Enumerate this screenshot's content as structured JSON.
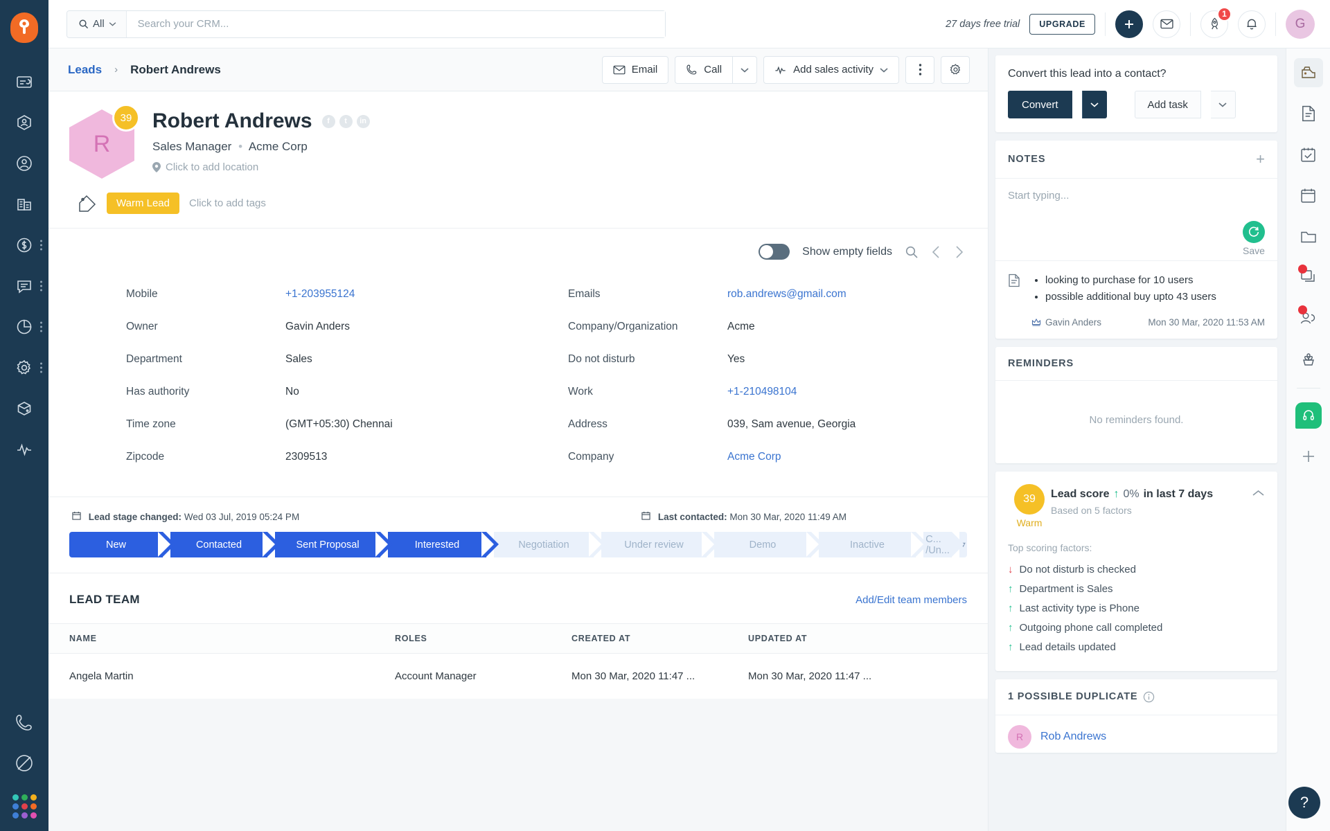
{
  "topbar": {
    "search_scope": "All",
    "search_placeholder": "Search your CRM...",
    "trial_text": "27 days free trial",
    "upgrade_label": "UPGRADE",
    "notification_badge": "1",
    "user_initial": "G"
  },
  "sidebar": {
    "items": [
      {
        "name": "dashboard",
        "label": "Dashboard",
        "dots": false
      },
      {
        "name": "leads",
        "label": "Leads",
        "dots": false
      },
      {
        "name": "contacts",
        "label": "Contacts",
        "dots": false
      },
      {
        "name": "accounts",
        "label": "Accounts",
        "dots": false
      },
      {
        "name": "deals",
        "label": "Deals",
        "dots": true
      },
      {
        "name": "conversations",
        "label": "Conversations",
        "dots": true
      },
      {
        "name": "reports",
        "label": "Reports",
        "dots": true
      },
      {
        "name": "settings",
        "label": "Settings",
        "dots": true
      },
      {
        "name": "products",
        "label": "Products",
        "dots": false
      },
      {
        "name": "activity",
        "label": "Activity",
        "dots": false
      }
    ],
    "bottom": [
      {
        "name": "phone",
        "label": "Phone"
      },
      {
        "name": "freshsales-leaf",
        "label": "Freshsales"
      }
    ]
  },
  "breadcrumb": {
    "parent": "Leads",
    "separator": "›",
    "current": "Robert Andrews"
  },
  "header_actions": {
    "email": "Email",
    "call": "Call",
    "add_sales_activity": "Add sales activity"
  },
  "profile": {
    "initial": "R",
    "score": "39",
    "name": "Robert Andrews",
    "job_title": "Sales Manager",
    "separator": "•",
    "company": "Acme Corp",
    "location_placeholder": "Click to add location",
    "tag": "Warm Lead",
    "tag_placeholder": "Click to add tags",
    "socials": [
      "facebook-icon",
      "twitter-icon",
      "linkedin-icon"
    ]
  },
  "fields_toolbar": {
    "show_empty_fields": "Show empty fields"
  },
  "fields": {
    "left": [
      {
        "label": "Mobile",
        "value": "+1-203955124",
        "link": true
      },
      {
        "label": "Owner",
        "value": "Gavin Anders",
        "link": false
      },
      {
        "label": "Department",
        "value": "Sales",
        "link": false
      },
      {
        "label": "Has authority",
        "value": "No",
        "link": false
      },
      {
        "label": "Time zone",
        "value": "(GMT+05:30) Chennai",
        "link": false
      },
      {
        "label": "Zipcode",
        "value": "2309513",
        "link": false
      }
    ],
    "right": [
      {
        "label": "Emails",
        "value": "rob.andrews@gmail.com",
        "link": true
      },
      {
        "label": "Company/Organization",
        "value": "Acme",
        "link": false
      },
      {
        "label": "Do not disturb",
        "value": "Yes",
        "link": false
      },
      {
        "label": "Work",
        "value": "+1-210498104",
        "link": true
      },
      {
        "label": "Address",
        "value": "039, Sam avenue, Georgia",
        "link": false
      },
      {
        "label": "Company",
        "value": "Acme Corp",
        "link": true
      }
    ]
  },
  "stage_section": {
    "changed_label": "Lead stage changed:",
    "changed_value": "Wed 03 Jul, 2019 05:24 PM",
    "contacted_label": "Last contacted:",
    "contacted_value": "Mon 30 Mar, 2020 11:49 AM",
    "stages": [
      {
        "label": "New",
        "done": true
      },
      {
        "label": "Contacted",
        "done": true
      },
      {
        "label": "Sent Proposal",
        "done": true
      },
      {
        "label": "Interested",
        "done": true
      },
      {
        "label": "Negotiation",
        "done": false
      },
      {
        "label": "Under review",
        "done": false
      },
      {
        "label": "Demo",
        "done": false
      },
      {
        "label": "Inactive",
        "done": false
      },
      {
        "label": "C... /Un...",
        "done": false
      }
    ]
  },
  "lead_team": {
    "title": "LEAD TEAM",
    "add_link": "Add/Edit team members",
    "columns": [
      "NAME",
      "ROLES",
      "CREATED AT",
      "UPDATED AT"
    ],
    "rows": [
      {
        "name": "Angela Martin",
        "role": "Account Manager",
        "created_at": "Mon 30 Mar, 2020 11:47 ...",
        "updated_at": "Mon 30 Mar, 2020 11:47 ..."
      }
    ]
  },
  "right_panel": {
    "convert": {
      "question": "Convert this lead into a contact?",
      "convert_label": "Convert",
      "add_task_label": "Add task"
    },
    "notes": {
      "title": "NOTES",
      "compose_placeholder": "Start typing...",
      "save_label": "Save",
      "entries": [
        {
          "bullets": [
            "looking to purchase for 10 users",
            "possible additional buy upto 43 users"
          ],
          "author": "Gavin Anders",
          "timestamp": "Mon 30 Mar, 2020 11:53 AM"
        }
      ]
    },
    "reminders": {
      "title": "REMINDERS",
      "empty": "No reminders found."
    },
    "lead_score": {
      "score": "39",
      "temperature": "Warm",
      "title": "Lead score",
      "change": "0%",
      "change_direction": "up",
      "change_suffix": "in last 7 days",
      "subtitle": "Based on 5 factors",
      "factors_label": "Top scoring factors:",
      "factors": [
        {
          "text": "Do not disturb is checked",
          "direction": "down"
        },
        {
          "text": "Department is Sales",
          "direction": "up"
        },
        {
          "text": "Last activity type is Phone",
          "direction": "up"
        },
        {
          "text": "Outgoing phone call completed",
          "direction": "up"
        },
        {
          "text": "Lead details updated",
          "direction": "up"
        }
      ]
    },
    "duplicates": {
      "title": "1 POSSIBLE DUPLICATE",
      "items": [
        {
          "initial": "R",
          "name": "Rob Andrews"
        }
      ]
    }
  },
  "right_rail": {
    "items": [
      {
        "name": "highlights",
        "badge": false,
        "active": true
      },
      {
        "name": "notes",
        "badge": false,
        "active": false
      },
      {
        "name": "tasks",
        "badge": false,
        "active": false
      },
      {
        "name": "appointments",
        "badge": false,
        "active": false
      },
      {
        "name": "files",
        "badge": false,
        "active": false
      },
      {
        "name": "emails",
        "badge": true,
        "active": false
      },
      {
        "name": "contacts",
        "badge": true,
        "active": false
      },
      {
        "name": "deals",
        "badge": false,
        "active": false
      }
    ],
    "chat_label": "Support chat",
    "add_label": "+",
    "help_label": "?"
  },
  "colors": {
    "brand_orange": "#f26b25",
    "sidebar_navy": "#1c3a52",
    "link_blue": "#3a74d0",
    "stage_blue": "#2c5fe0",
    "warm_yellow": "#f5c026",
    "avatar_pink": "#f0b8dd",
    "success_green": "#21bf8e",
    "danger_red": "#e0414b"
  }
}
